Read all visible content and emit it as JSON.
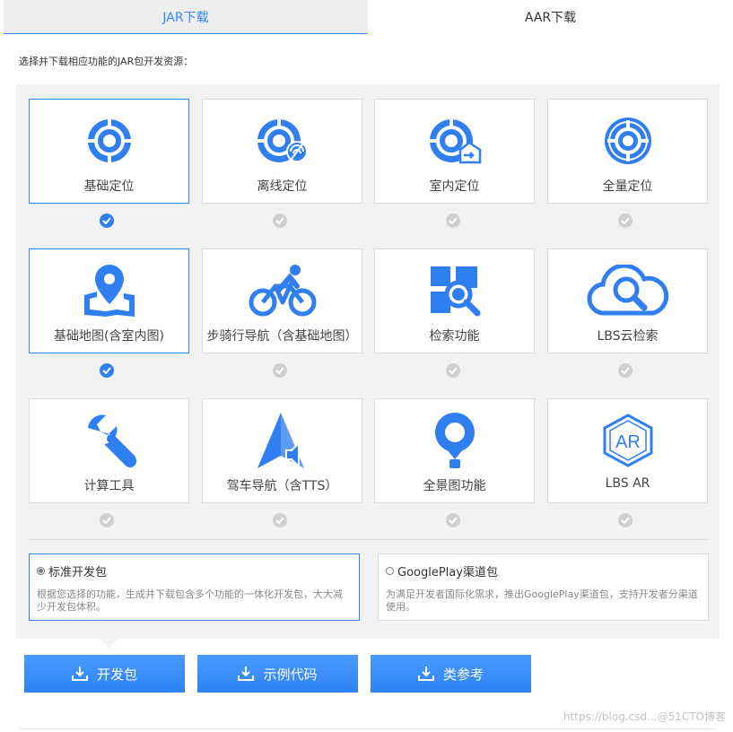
{
  "tabs": {
    "jar": "JAR下载",
    "aar": "AAR下载"
  },
  "intro": "选择并下载相应功能的JAR包开发资源：",
  "features": [
    {
      "label": "基础定位",
      "icon": "location-target-icon",
      "selected": true
    },
    {
      "label": "离线定位",
      "icon": "offline-location-icon",
      "selected": false
    },
    {
      "label": "室内定位",
      "icon": "indoor-location-icon",
      "selected": false
    },
    {
      "label": "全量定位",
      "icon": "full-location-icon",
      "selected": false
    },
    {
      "label": "基础地图(含室内图)",
      "icon": "map-pin-icon",
      "selected": true
    },
    {
      "label": "步骑行导航（含基础地图）",
      "icon": "cyclist-icon",
      "selected": false
    },
    {
      "label": "检索功能",
      "icon": "search-grid-icon",
      "selected": false
    },
    {
      "label": "LBS云检索",
      "icon": "cloud-search-icon",
      "selected": false
    },
    {
      "label": "计算工具",
      "icon": "wrench-icon",
      "selected": false
    },
    {
      "label": "驾车导航（含TTS）",
      "icon": "navigation-arrow-icon",
      "selected": false
    },
    {
      "label": "全景图功能",
      "icon": "panorama-pin-icon",
      "selected": false
    },
    {
      "label": "LBS AR",
      "icon": "ar-hexagon-icon",
      "selected": false
    }
  ],
  "ar_badge": "AR",
  "packages": {
    "standard": {
      "title": "标准开发包",
      "desc": "根据您选择的功能，生成并下载包含多个功能的一体化开发包，大大减少开发包体积。",
      "selected": true
    },
    "googleplay": {
      "title": "GooglePlay渠道包",
      "desc": "为满足开发者国际化需求，推出GooglePlay渠道包，支持开发者分渠道使用。",
      "selected": false
    }
  },
  "buttons": {
    "dev": "开发包",
    "sample": "示例代码",
    "ref": "类参考"
  },
  "watermark": "https://blog.csd...@51CTO博客",
  "colors": {
    "accent": "#3385ff",
    "icon": "#2f7ff0",
    "check_off": "#cfcfcf"
  }
}
